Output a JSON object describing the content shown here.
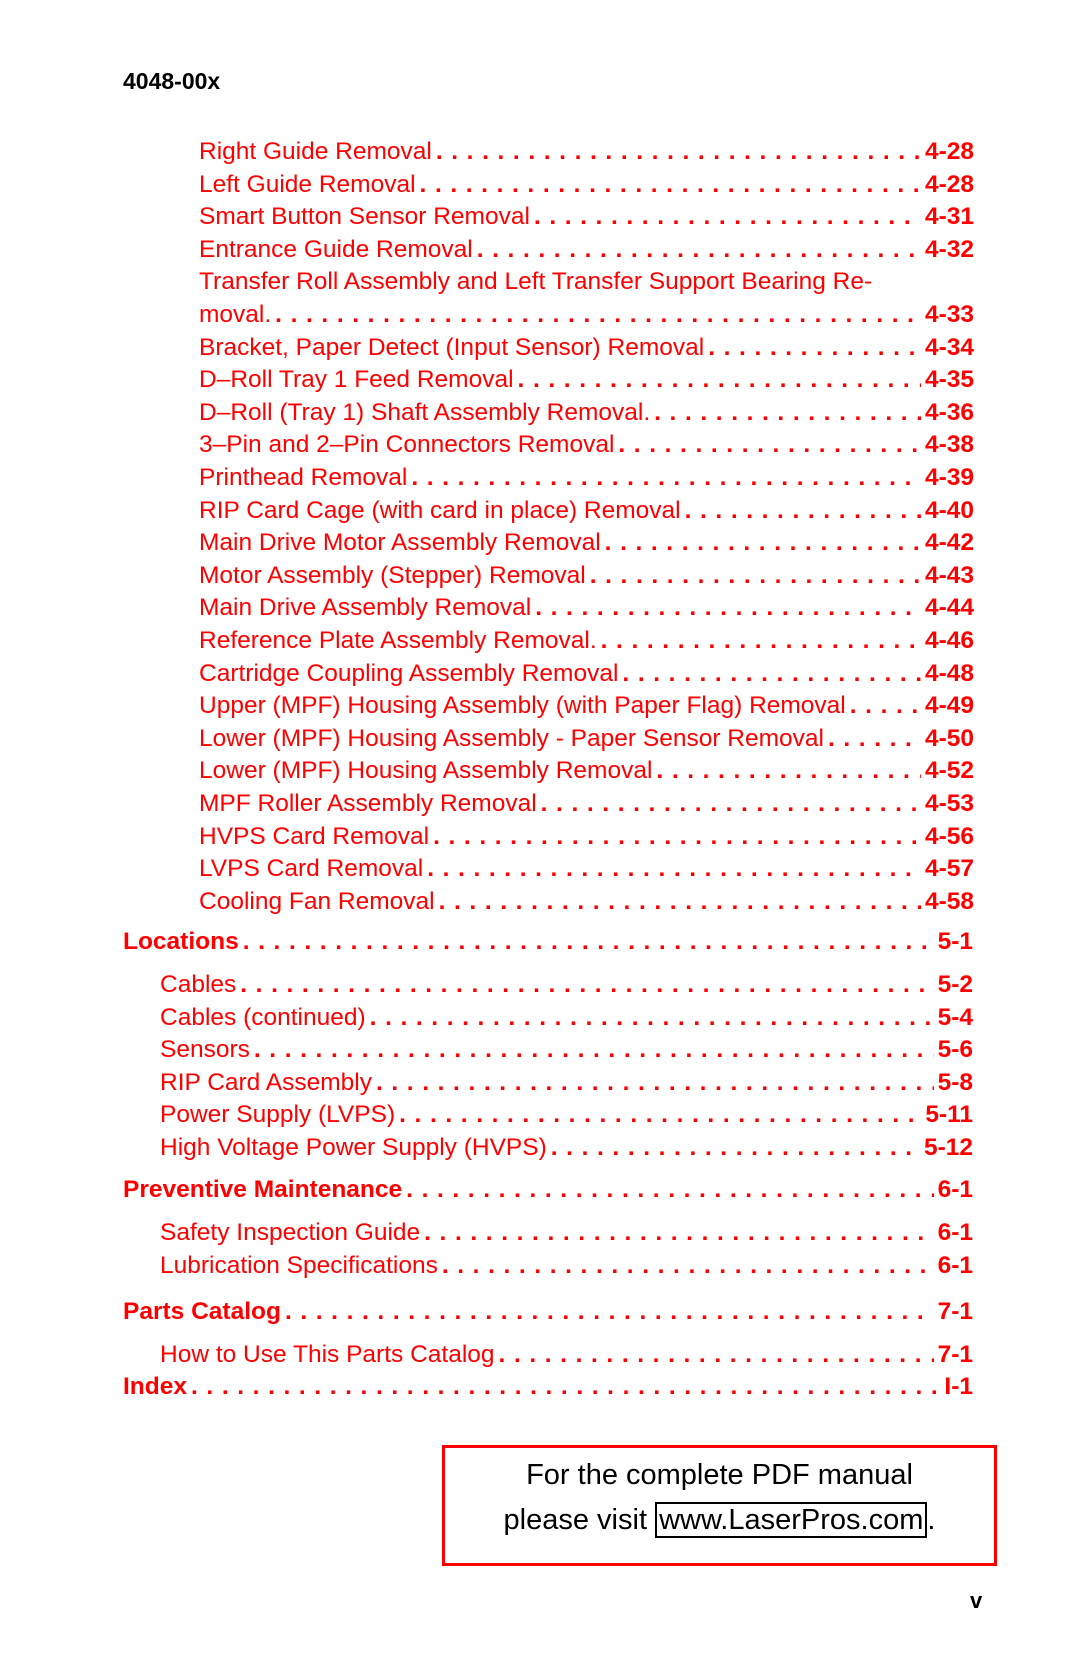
{
  "header": {
    "doc_id": "4048-00x"
  },
  "toc": {
    "entries_removal": [
      {
        "title": "Right Guide Removal",
        "page": "4-28"
      },
      {
        "title": "Left Guide Removal",
        "page": "4-28"
      },
      {
        "title": "Smart Button Sensor Removal",
        "page": "4-31"
      },
      {
        "title": "Entrance Guide Removal",
        "page": "4-32"
      },
      {
        "title_line1": "Transfer Roll Assembly and Left Transfer Support Bearing Re-",
        "title": "moval.",
        "page": "4-33"
      },
      {
        "title": "Bracket, Paper Detect (Input Sensor) Removal",
        "page": "4-34"
      },
      {
        "title": "D–Roll Tray 1 Feed Removal",
        "page": "4-35"
      },
      {
        "title": "D–Roll (Tray 1) Shaft Assembly Removal.",
        "page": "4-36"
      },
      {
        "title": "3–Pin and 2–Pin Connectors Removal",
        "page": "4-38"
      },
      {
        "title": "Printhead Removal",
        "page": "4-39"
      },
      {
        "title": "RIP Card Cage (with card in place) Removal",
        "page": "4-40"
      },
      {
        "title": "Main Drive Motor Assembly Removal",
        "page": "4-42"
      },
      {
        "title": "Motor Assembly (Stepper) Removal",
        "page": "4-43"
      },
      {
        "title": "Main Drive Assembly Removal",
        "page": "4-44"
      },
      {
        "title": "Reference Plate Assembly Removal.",
        "page": "4-46"
      },
      {
        "title": "Cartridge Coupling Assembly Removal",
        "page": "4-48"
      },
      {
        "title": "Upper (MPF) Housing Assembly (with Paper Flag) Removal",
        "page": "4-49"
      },
      {
        "title": "Lower (MPF) Housing Assembly - Paper Sensor Removal",
        "page": "4-50"
      },
      {
        "title": "Lower (MPF) Housing Assembly Removal",
        "page": "4-52"
      },
      {
        "title": "MPF Roller Assembly Removal",
        "page": "4-53"
      },
      {
        "title": "HVPS Card Removal",
        "page": "4-56"
      },
      {
        "title": "LVPS Card Removal",
        "page": "4-57"
      },
      {
        "title": "Cooling Fan Removal",
        "page": "4-58"
      }
    ],
    "locations": {
      "title": "Locations",
      "page": "5-1"
    },
    "locations_entries": [
      {
        "title": "Cables",
        "page": "5-2"
      },
      {
        "title": "Cables (continued)",
        "page": "5-4"
      },
      {
        "title": "Sensors",
        "page": "5-6"
      },
      {
        "title": "RIP Card Assembly",
        "page": "5-8"
      },
      {
        "title": "Power Supply (LVPS)",
        "page": "5-11"
      },
      {
        "title": "High Voltage Power Supply (HVPS)",
        "page": "5-12"
      }
    ],
    "preventive": {
      "title": "Preventive Maintenance",
      "page": "6-1"
    },
    "preventive_entries": [
      {
        "title": "Safety Inspection Guide",
        "page": "6-1"
      },
      {
        "title": "Lubrication Specifications",
        "page": "6-1"
      }
    ],
    "parts": {
      "title": "Parts Catalog",
      "page": "7-1"
    },
    "parts_entries": [
      {
        "title": "How to Use This Parts Catalog",
        "page": "7-1"
      }
    ],
    "index": {
      "title": "Index",
      "page": "I-1"
    }
  },
  "notice": {
    "line1": "For the complete PDF manual",
    "line2_prefix": "please visit ",
    "link": "www.LaserPros.com",
    "line2_suffix": "."
  },
  "footer": {
    "page_number": "v"
  },
  "colors": {
    "link_red": "#ff0000",
    "text": "#000000"
  }
}
